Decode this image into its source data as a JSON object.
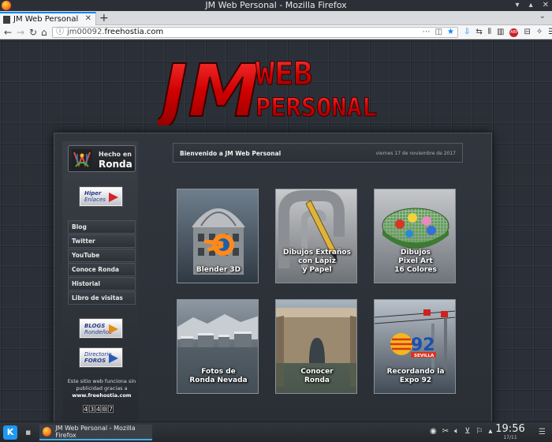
{
  "window": {
    "title": "JM Web Personal - Mozilla Firefox"
  },
  "tabs": [
    {
      "label": "JM Web Personal"
    }
  ],
  "nav": {
    "url_prefix": "jm00092.",
    "url_host": "freehostia.com"
  },
  "logo": {
    "line1": "JM",
    "line2": "WEB",
    "line3": "PERSONAL"
  },
  "sidebar": {
    "hecho_en": "Hecho en",
    "ronda": "Ronda",
    "hiper_1": "Hiper",
    "hiper_2": "Enlaces",
    "menu": [
      {
        "label": "Blog"
      },
      {
        "label": "Twitter"
      },
      {
        "label": "YouTube"
      },
      {
        "label": "Conoce Ronda"
      },
      {
        "label": "Historial"
      },
      {
        "label": "Libro de visitas"
      }
    ],
    "blogs_1": "BLOGS",
    "blogs_2": "Rondeños",
    "foros_1": "Directorio",
    "foros_2": "FOROS",
    "support_text": "Este sitio web funciona sin publicidad gracias a",
    "support_host": "www.freehostia.com",
    "counter": [
      "4",
      "3",
      "4",
      "0",
      "7"
    ]
  },
  "main": {
    "welcome": "Bienvenido a JM Web Personal",
    "date": "viernes 17 de noviembre de 2017",
    "tiles": [
      {
        "caption": "Blender 3D"
      },
      {
        "caption": "Dibujos Extraños\ncon Lápiz\ny Papel"
      },
      {
        "caption": "Dibujos\nPixel Art\n16 Colores"
      },
      {
        "caption": "Fotos de\nRonda Nevada"
      },
      {
        "caption": "Conocer\nRonda"
      },
      {
        "caption": "Recordando la\nExpo 92"
      }
    ],
    "expo_number": "92",
    "expo_city": "SEVILLA"
  },
  "taskbar": {
    "window_label": "JM Web Personal - Mozilla Firefox",
    "time": "19:56",
    "date": "17/11"
  }
}
